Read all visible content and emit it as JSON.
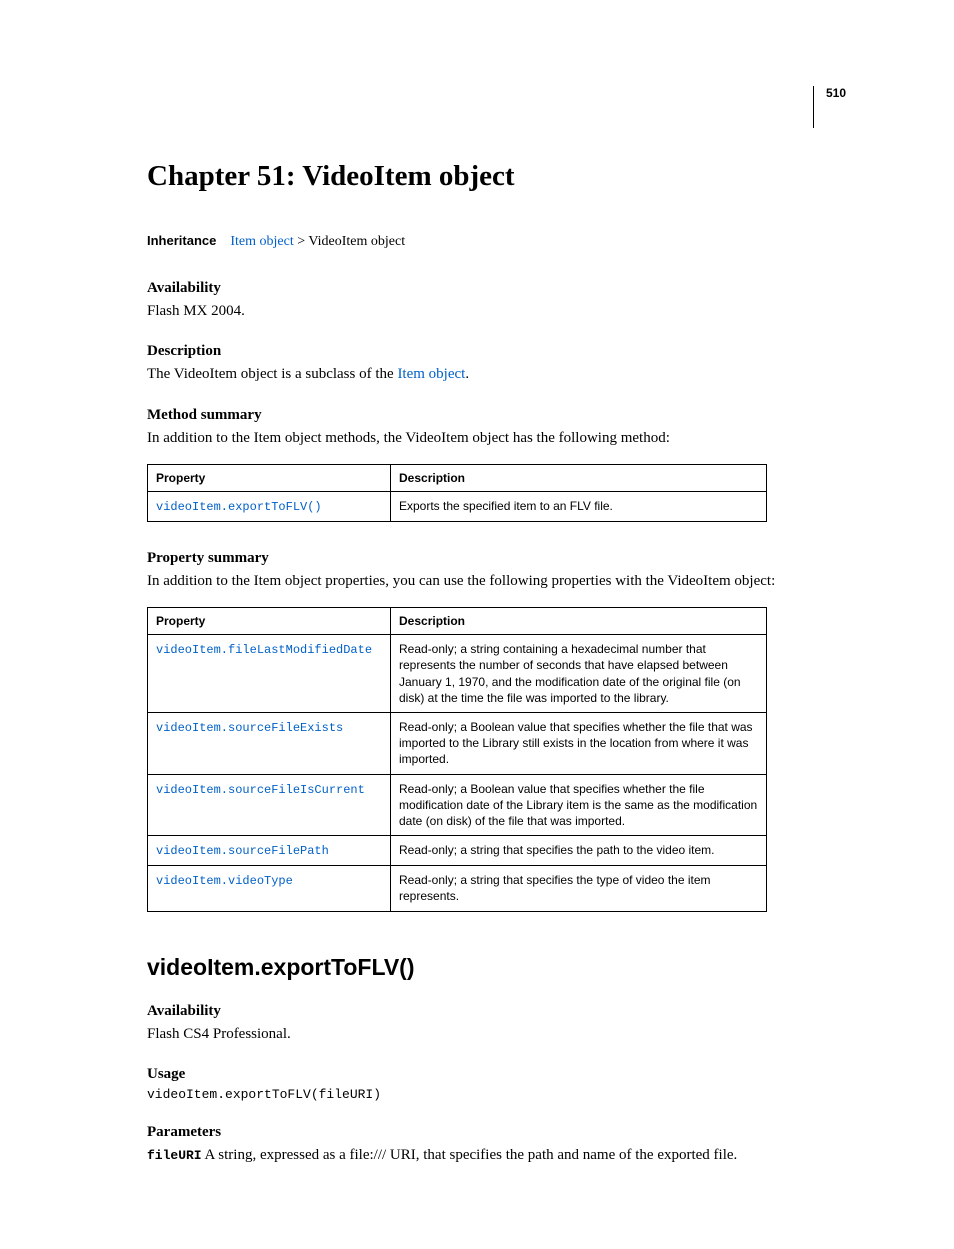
{
  "pageNumber": "510",
  "chapter": {
    "title": "Chapter 51: VideoItem object"
  },
  "inheritance": {
    "label": "Inheritance",
    "link": "Item object",
    "suffix": " > VideoItem object"
  },
  "sections": {
    "availability": {
      "heading": "Availability",
      "text": "Flash MX 2004."
    },
    "description": {
      "heading": "Description",
      "prefix": "The VideoItem object is a subclass of the ",
      "link": "Item object",
      "suffix": "."
    },
    "methodSummary": {
      "heading": "Method summary",
      "intro": "In addition to the Item object methods, the VideoItem object has the following method:",
      "headers": {
        "col1": "Property",
        "col2": "Description"
      },
      "rows": [
        {
          "prop": "videoItem.exportToFLV()",
          "desc": "Exports the specified item to an FLV file."
        }
      ]
    },
    "propertySummary": {
      "heading": "Property summary",
      "intro": "In addition to the Item object properties, you can use the following properties with the VideoItem object:",
      "headers": {
        "col1": "Property",
        "col2": "Description"
      },
      "rows": [
        {
          "prop": "videoItem.fileLastModifiedDate",
          "desc": "Read-only; a string containing a hexadecimal number that represents the number of seconds that have elapsed between January 1, 1970, and the modification date of the original file (on disk) at the time the file was imported to the library."
        },
        {
          "prop": "videoItem.sourceFileExists",
          "desc": "Read-only; a Boolean value that specifies whether the file that was imported to the Library still exists in the location from where it was imported."
        },
        {
          "prop": "videoItem.sourceFileIsCurrent",
          "desc": "Read-only; a Boolean value that specifies whether the file modification date of the Library item is the same as the modification date (on disk) of the file that was imported."
        },
        {
          "prop": "videoItem.sourceFilePath",
          "desc": "Read-only; a string that specifies the path to the video item."
        },
        {
          "prop": "videoItem.videoType",
          "desc": "Read-only; a string that specifies the type of video the item represents."
        }
      ]
    }
  },
  "method": {
    "title": "videoItem.exportToFLV()",
    "availability": {
      "heading": "Availability",
      "text": "Flash CS4 Professional."
    },
    "usage": {
      "heading": "Usage",
      "code": "videoItem.exportToFLV(fileURI)"
    },
    "parameters": {
      "heading": "Parameters",
      "paramName": "fileURI",
      "paramText": "  A string, expressed as a file:/// URI, that specifies the path and name of the exported file."
    }
  }
}
